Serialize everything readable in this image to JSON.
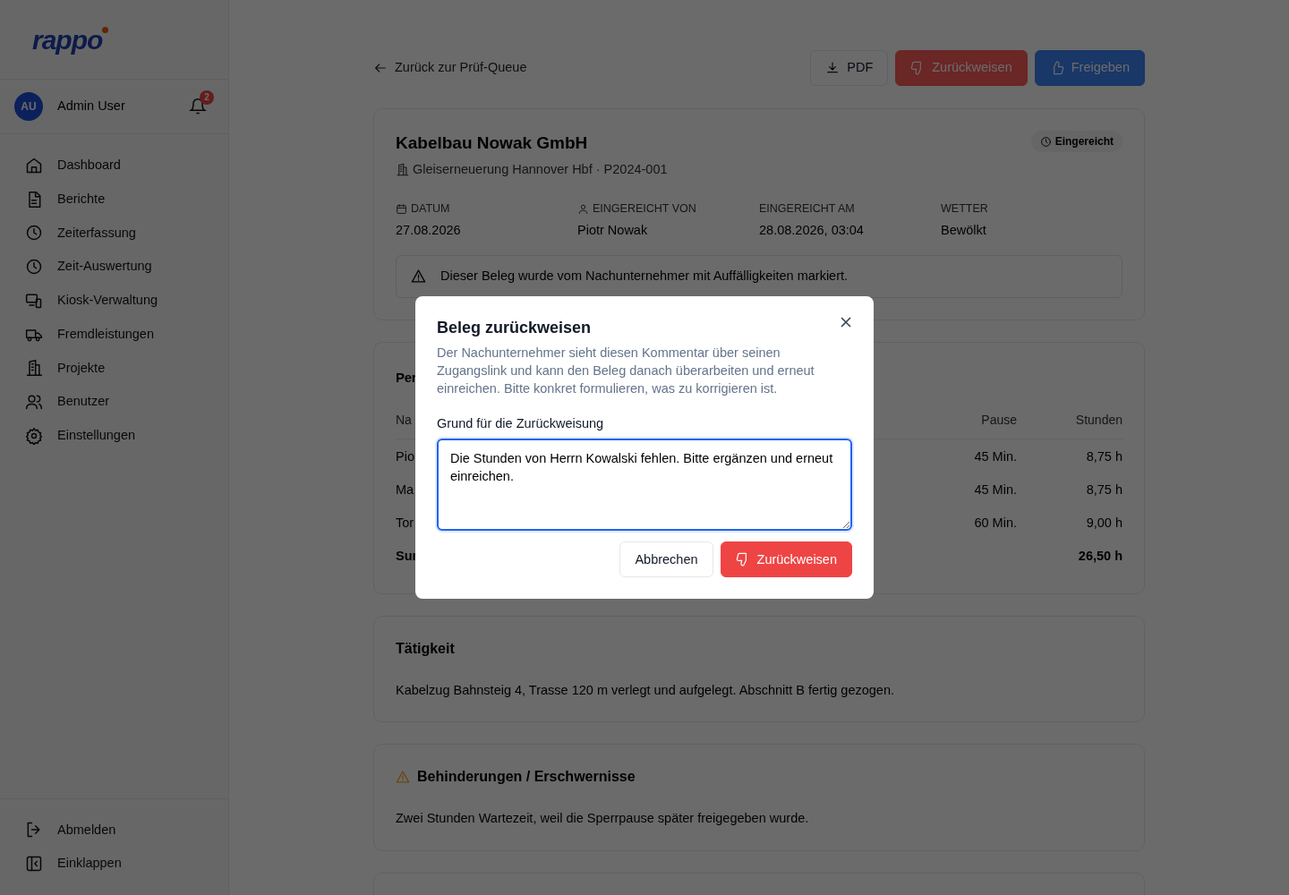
{
  "sidebar": {
    "logo": "rappo",
    "user": {
      "initials": "AU",
      "name": "Admin User",
      "notifications": "2"
    },
    "items": [
      {
        "label": "Dashboard",
        "selected": false
      },
      {
        "label": "Berichte",
        "selected": false
      },
      {
        "label": "Zeiterfassung",
        "selected": false
      },
      {
        "label": "Zeit-Auswertung",
        "selected": false
      },
      {
        "label": "Kiosk-Verwaltung",
        "selected": false
      },
      {
        "label": "Fremdleistungen",
        "selected": false
      },
      {
        "label": "Projekte",
        "selected": false
      },
      {
        "label": "Benutzer",
        "selected": false
      },
      {
        "label": "Einstellungen",
        "selected": false
      }
    ],
    "footer": [
      "Abmelden",
      "Einklappen"
    ]
  },
  "toolbar": {
    "back": "Zurück zur Prüf-Queue",
    "buttons": [
      {
        "label": "PDF",
        "kind": "outline"
      },
      {
        "label": "Zurückweisen",
        "kind": "danger"
      },
      {
        "label": "Freigeben",
        "kind": "primary"
      }
    ]
  },
  "report": {
    "title": "Kabelbau Nowak GmbH",
    "project": "Gleiserneuerung Hannover Hbf · P2024-001",
    "status": "Eingereicht",
    "meta": [
      {
        "label": "DATUM",
        "value": "27.08.2026"
      },
      {
        "label": "EINGEREICHT VON",
        "value": "Piotr Nowak"
      },
      {
        "label": "EINGEREICHT AM",
        "value": "28.08.2026, 03:04"
      },
      {
        "label": "WETTER",
        "value": "Bewölkt"
      }
    ],
    "alert": "Dieser Beleg wurde vom Nachunternehmer mit Auffälligkeiten markiert."
  },
  "personnel": {
    "title": "Per",
    "columns": [
      "Na",
      "Pause",
      "Stunden"
    ],
    "rows": [
      {
        "kind": "row",
        "name": "Pio",
        "pause": "45 Min.",
        "hours": "8,75 h"
      },
      {
        "kind": "row",
        "name": "Ma",
        "pause": "45 Min.",
        "hours": "8,75 h"
      },
      {
        "kind": "row",
        "name": "Tor",
        "pause": "60 Min.",
        "hours": "9,00 h"
      },
      {
        "kind": "sum",
        "name": "Sur",
        "hours": "26,50 h"
      }
    ]
  },
  "activity": {
    "title": "Tätigkeit",
    "text": "Kabelzug Bahnsteig 4, Trasse 120 m verlegt und aufgelegt. Abschnitt B fertig gezogen."
  },
  "obstacles": {
    "title": "Behinderungen / Erschwernisse",
    "text": "Zwei Stunden Wartezeit, weil die Sperrpause später freigegeben wurde."
  },
  "modal": {
    "title": "Beleg zurückweisen",
    "description": "Der Nachunternehmer sieht diesen Kommentar über seinen Zugangslink und kann den Beleg danach überarbeiten und erneut einreichen. Bitte konkret formulieren, was zu korrigieren ist.",
    "field_label": "Grund für die Zurückweisung",
    "value": "Die Stunden von Herrn Kowalski fehlen. Bitte ergänzen und erneut einreichen.",
    "buttons": [
      {
        "label": "Abbrechen",
        "kind": "outline"
      },
      {
        "label": "Zurückweisen",
        "kind": "danger"
      }
    ]
  }
}
